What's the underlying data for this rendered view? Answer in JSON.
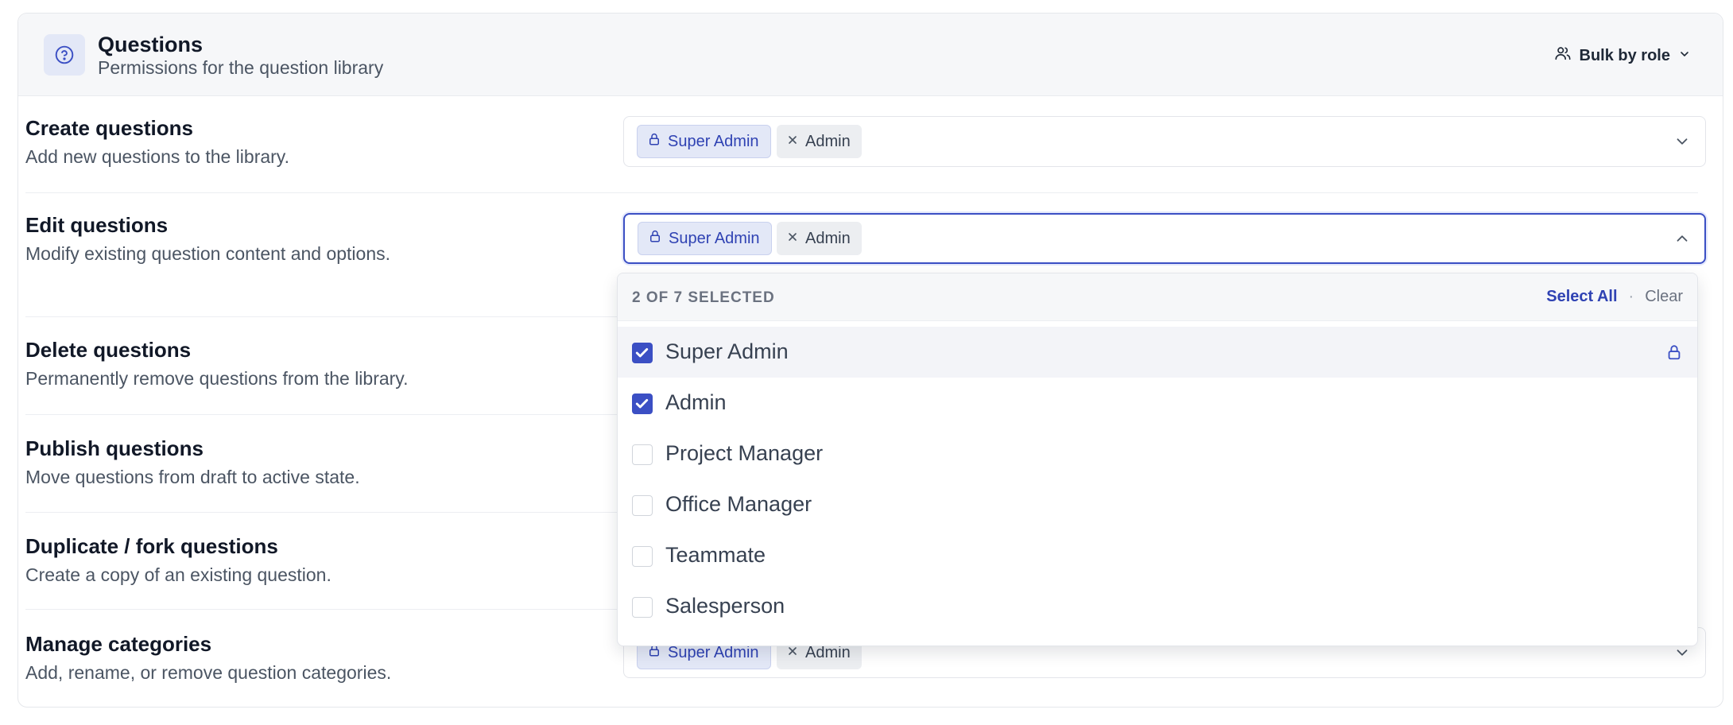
{
  "header": {
    "title": "Questions",
    "subtitle": "Permissions for the question library",
    "bulk_label": "Bulk by role",
    "icon": "help-circle-icon"
  },
  "chips": {
    "locked": "Super Admin",
    "removable": "Admin"
  },
  "permissions": [
    {
      "title": "Create questions",
      "desc": "Add new questions to the library."
    },
    {
      "title": "Edit questions",
      "desc": "Modify existing question content and options."
    },
    {
      "title": "Delete questions",
      "desc": "Permanently remove questions from the library."
    },
    {
      "title": "Publish questions",
      "desc": "Move questions from draft to active state."
    },
    {
      "title": "Duplicate / fork questions",
      "desc": "Create a copy of an existing question."
    },
    {
      "title": "Manage categories",
      "desc": "Add, rename, or remove question categories."
    }
  ],
  "dropdown": {
    "count_label": "2 OF 7 SELECTED",
    "select_all": "Select All",
    "separator": "·",
    "clear": "Clear",
    "options": [
      {
        "label": "Super Admin",
        "checked": true,
        "locked": true
      },
      {
        "label": "Admin",
        "checked": true,
        "locked": false
      },
      {
        "label": "Project Manager",
        "checked": false,
        "locked": false
      },
      {
        "label": "Office Manager",
        "checked": false,
        "locked": false
      },
      {
        "label": "Teammate",
        "checked": false,
        "locked": false
      },
      {
        "label": "Salesperson",
        "checked": false,
        "locked": false
      }
    ]
  },
  "colors": {
    "accent": "#3b4fc4",
    "chip_locked_bg": "#e3e8f7",
    "chip_removable_bg": "#eceef1"
  }
}
